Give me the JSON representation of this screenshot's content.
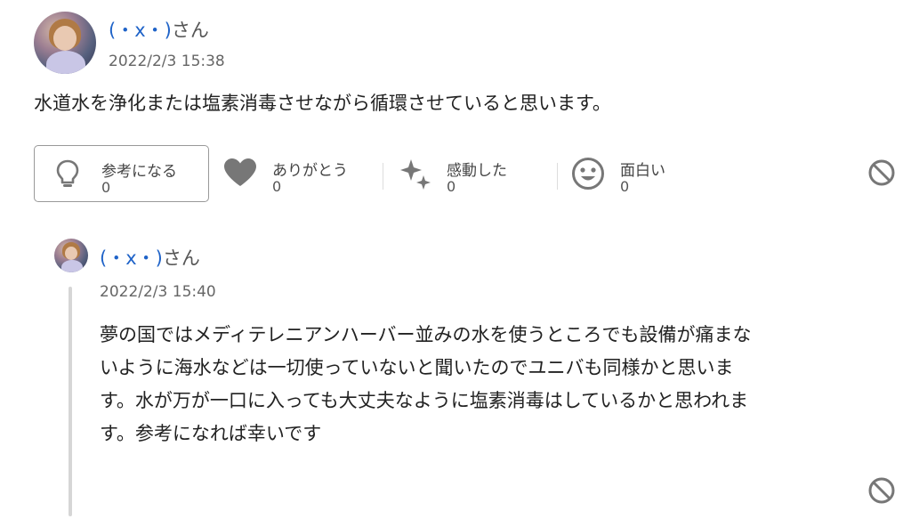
{
  "question_comment": {
    "user_name": "(・x・)",
    "user_suffix": "さん",
    "date": "2022/2/3 15:38",
    "text": "水道水を浄化または塩素消毒させながら循環させていると思います。",
    "reactions": [
      {
        "label": "参考になる",
        "count": "0",
        "icon": "lightbulb-icon"
      },
      {
        "label": "ありがとう",
        "count": "0",
        "icon": "heart-icon"
      },
      {
        "label": "感動した",
        "count": "0",
        "icon": "sparkle-icon"
      },
      {
        "label": "面白い",
        "count": "0",
        "icon": "smile-icon"
      }
    ],
    "report_icon": "block-icon"
  },
  "reply_comment": {
    "user_name": "(・x・)",
    "user_suffix": "さん",
    "date": "2022/2/3 15:40",
    "lines": [
      "夢の国ではメディテレニアンハーバー並みの水を使うところでも設備が痛まな",
      "いように海水などは一切使っていないと聞いたのでユニバも同様かと思いま",
      "す。水が万が一口に入っても大丈夫なように塩素消毒はしているかと思われま",
      "す。参考になれば幸いです"
    ],
    "report_icon": "block-icon"
  },
  "colors": {
    "user_link": "#1f63c8",
    "icon_gray": "#777777",
    "thread_line": "#d6d6d6"
  }
}
